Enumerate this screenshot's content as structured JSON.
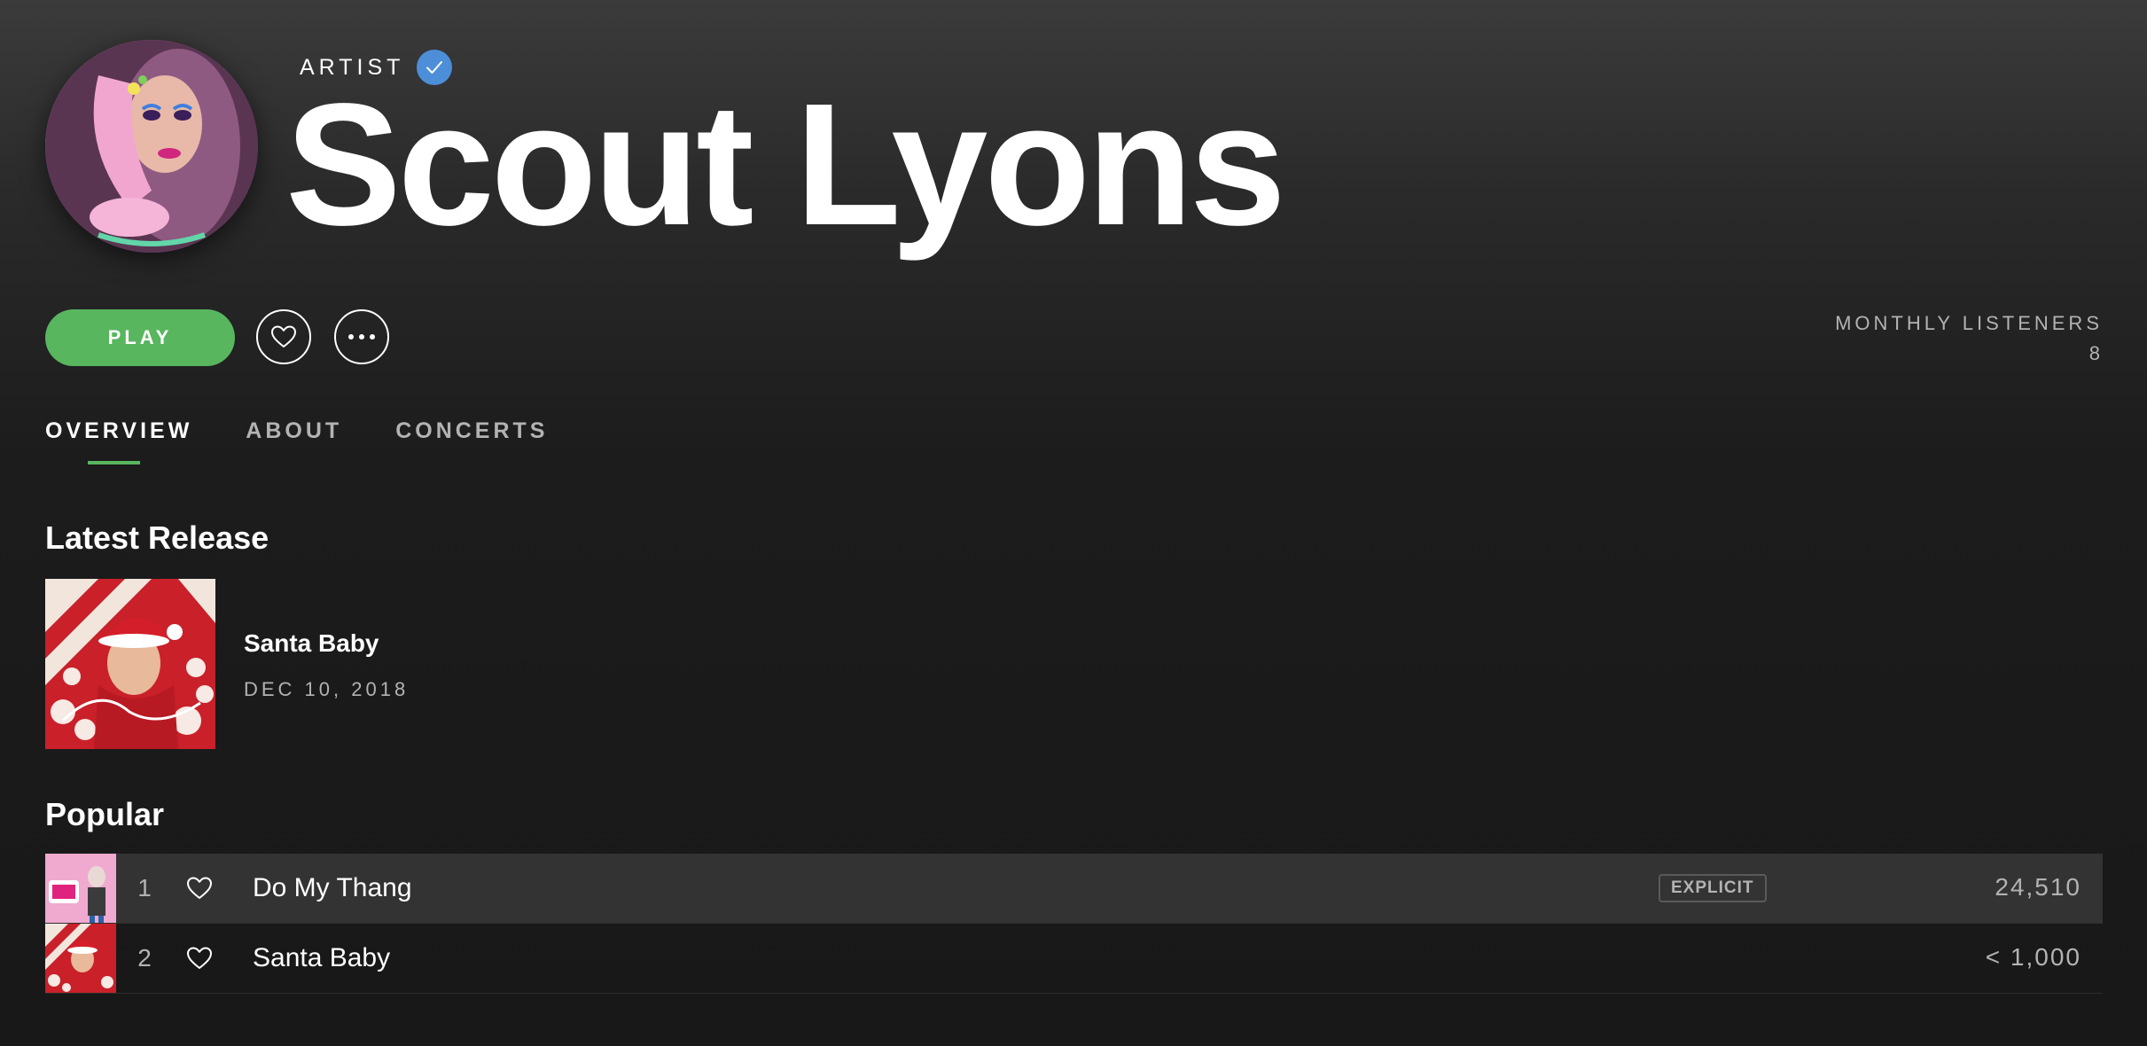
{
  "artist": {
    "label": "ARTIST",
    "name": "Scout Lyons",
    "verified": true
  },
  "actions": {
    "play_label": "PLAY",
    "follow_icon": "heart-icon",
    "more_icon": "more-horizontal-icon"
  },
  "listeners": {
    "label": "MONTHLY LISTENERS",
    "count": "8"
  },
  "tabs": [
    {
      "label": "OVERVIEW",
      "active": true
    },
    {
      "label": "ABOUT",
      "active": false
    },
    {
      "label": "CONCERTS",
      "active": false
    }
  ],
  "latest_release": {
    "heading": "Latest Release",
    "title": "Santa Baby",
    "date": "DEC 10, 2018"
  },
  "popular": {
    "heading": "Popular",
    "tracks": [
      {
        "number": "1",
        "title": "Do My Thang",
        "explicit_label": "EXPLICIT",
        "plays": "24,510"
      },
      {
        "number": "2",
        "title": "Santa Baby",
        "explicit_label": "",
        "plays": "< 1,000"
      }
    ]
  },
  "colors": {
    "accent_green": "#58b65f",
    "verified_blue": "#4d8ed8",
    "text_secondary": "#b3b3b3",
    "row_highlight": "#333333"
  }
}
